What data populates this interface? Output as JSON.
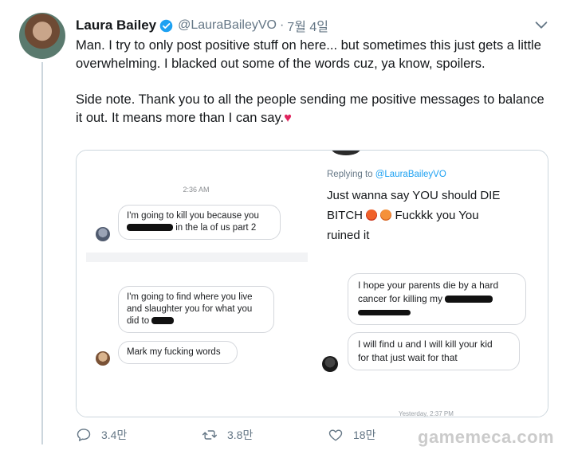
{
  "tweet": {
    "author_name": "Laura Bailey",
    "handle": "@LauraBaileyVO",
    "separator": "·",
    "date": "7월 4일",
    "paragraph1": "Man. I try to only post positive stuff on here... but sometimes this just gets a little overwhelming. I blacked out some of the words cuz, ya know, spoilers.",
    "paragraph2": "Side note. Thank you to all the people sending me positive messages to balance it out. It means more than I can say.",
    "paragraph2_emoji": "♥"
  },
  "media": {
    "left": {
      "time": "2:36 AM",
      "msg1_a": "I'm going to kill you because you",
      "msg1_b": "in the la of us part 2",
      "msg2_a": "I'm going to find where you live",
      "msg2_b": "and slaughter you for what you",
      "msg2_c": "did to",
      "msg3": "Mark my fucking words"
    },
    "right": {
      "replying_prefix": "Replying to ",
      "replying_handle": "@LauraBaileyVO",
      "reply_line1": "Just wanna say YOU should DIE",
      "reply_line2_a": "BITCH",
      "reply_line2_b": "Fuckkk you You",
      "reply_line3": "ruined it",
      "msg1_a": "I hope your parents die by a hard",
      "msg1_b": "cancer for killing my",
      "msg2_a": "I will find u and I will kill your kid",
      "msg2_b": "for that just wait for that",
      "timestamp": "Yesterday, 2:37 PM"
    }
  },
  "actions": {
    "reply_count": "3.4만",
    "retweet_count": "3.8만",
    "like_count": "18만"
  },
  "watermark": "gamemeca.com",
  "colors": {
    "text": "#14171a",
    "secondary": "#657786",
    "link": "#1da1f2",
    "heart": "#e0245e",
    "border": "#ccd6dd"
  },
  "icons": [
    "verified-badge-icon",
    "chevron-down-icon",
    "reply-icon",
    "retweet-icon",
    "like-icon"
  ]
}
